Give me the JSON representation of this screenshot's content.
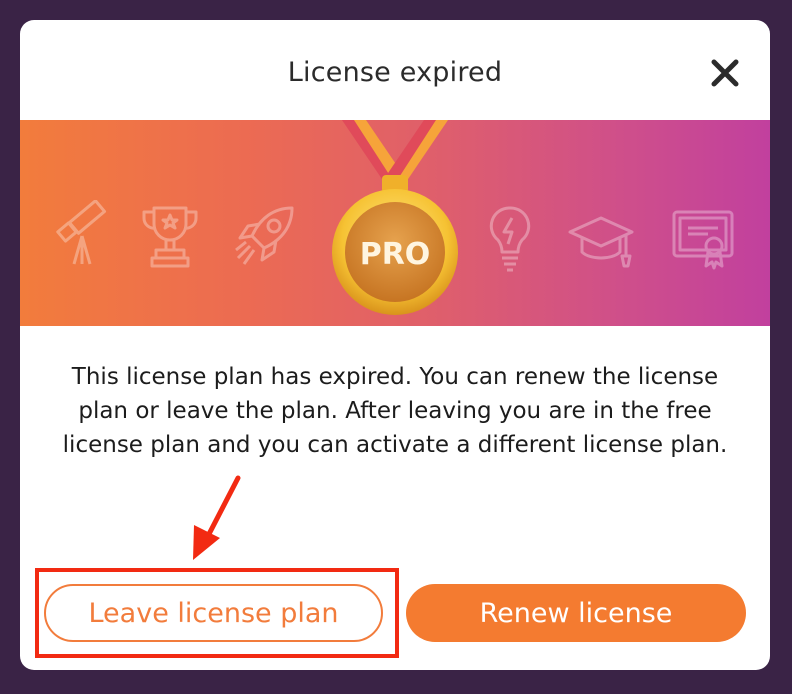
{
  "dialog": {
    "title": "License expired",
    "close_icon": "close-icon",
    "badge_label": "PRO",
    "message": "This license plan has expired. You can renew the license plan or leave the plan. After leaving you are in the free license plan and you can activate a different license plan.",
    "leave_button_label": "Leave license plan",
    "renew_button_label": "Renew license"
  },
  "banner": {
    "icons": [
      "telescope-icon",
      "trophy-icon",
      "rocket-icon",
      "medal-icon",
      "lightbulb-icon",
      "graduation-cap-icon",
      "certificate-icon"
    ]
  },
  "colors": {
    "accent": "#f47b30",
    "background": "#3a2346",
    "annotation": "#f22a12"
  }
}
